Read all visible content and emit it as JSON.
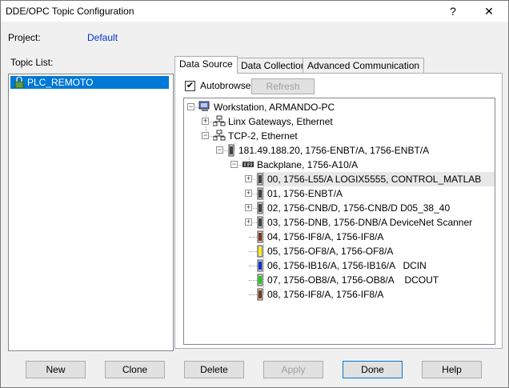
{
  "window": {
    "title": "DDE/OPC Topic Configuration",
    "help_glyph": "?",
    "close_glyph": "✕"
  },
  "project": {
    "label": "Project:",
    "value": "Default"
  },
  "topic_list": {
    "label": "Topic List:",
    "items": [
      "PLC_REMOTO"
    ]
  },
  "tabs": [
    "Data Source",
    "Data Collection",
    "Advanced Communication"
  ],
  "data_source": {
    "autobrowse_label": "Autobrowse",
    "autobrowse_checked": true,
    "refresh_label": "Refresh"
  },
  "tree": [
    {
      "text": "Workstation, ARMANDO-PC",
      "icon": "workstation-icon"
    },
    {
      "text": "Linx Gateways, Ethernet",
      "icon": "network-icon"
    },
    {
      "text": "TCP-2, Ethernet",
      "icon": "network-icon"
    },
    {
      "text": "181.49.188.20, 1756-ENBT/A, 1756-ENBT/A",
      "icon": "module-icon"
    },
    {
      "text": "Backplane, 1756-A10/A",
      "icon": "backplane-icon"
    },
    {
      "text": "00, 1756-L55/A LOGIX5555, CONTROL_MATLAB",
      "icon": "module-icon"
    },
    {
      "text": "01, 1756-ENBT/A",
      "icon": "module-icon"
    },
    {
      "text": "02, 1756-CNB/D, 1756-CNB/D D05_38_40",
      "icon": "module-icon"
    },
    {
      "text": "03, 1756-DNB, 1756-DNB/A DeviceNet Scanner",
      "icon": "module-icon"
    },
    {
      "text": "04, 1756-IF8/A, 1756-IF8/A",
      "icon": "module-icon",
      "color": "#7a3a1a"
    },
    {
      "text": "05, 1756-OF8/A, 1756-OF8/A",
      "icon": "module-icon",
      "color": "#ffee00"
    },
    {
      "text": "06, 1756-IB16/A, 1756-IB16/A   DCIN",
      "icon": "module-icon",
      "color": "#0033cc"
    },
    {
      "text": "07, 1756-OB8/A, 1756-OB8/A    DCOUT",
      "icon": "module-icon",
      "color": "#22cc22"
    },
    {
      "text": "08, 1756-IF8/A, 1756-IF8/A",
      "icon": "module-icon",
      "color": "#7a3a1a"
    }
  ],
  "buttons": {
    "new": "New",
    "clone": "Clone",
    "delete": "Delete",
    "apply": "Apply",
    "done": "Done",
    "help": "Help"
  }
}
